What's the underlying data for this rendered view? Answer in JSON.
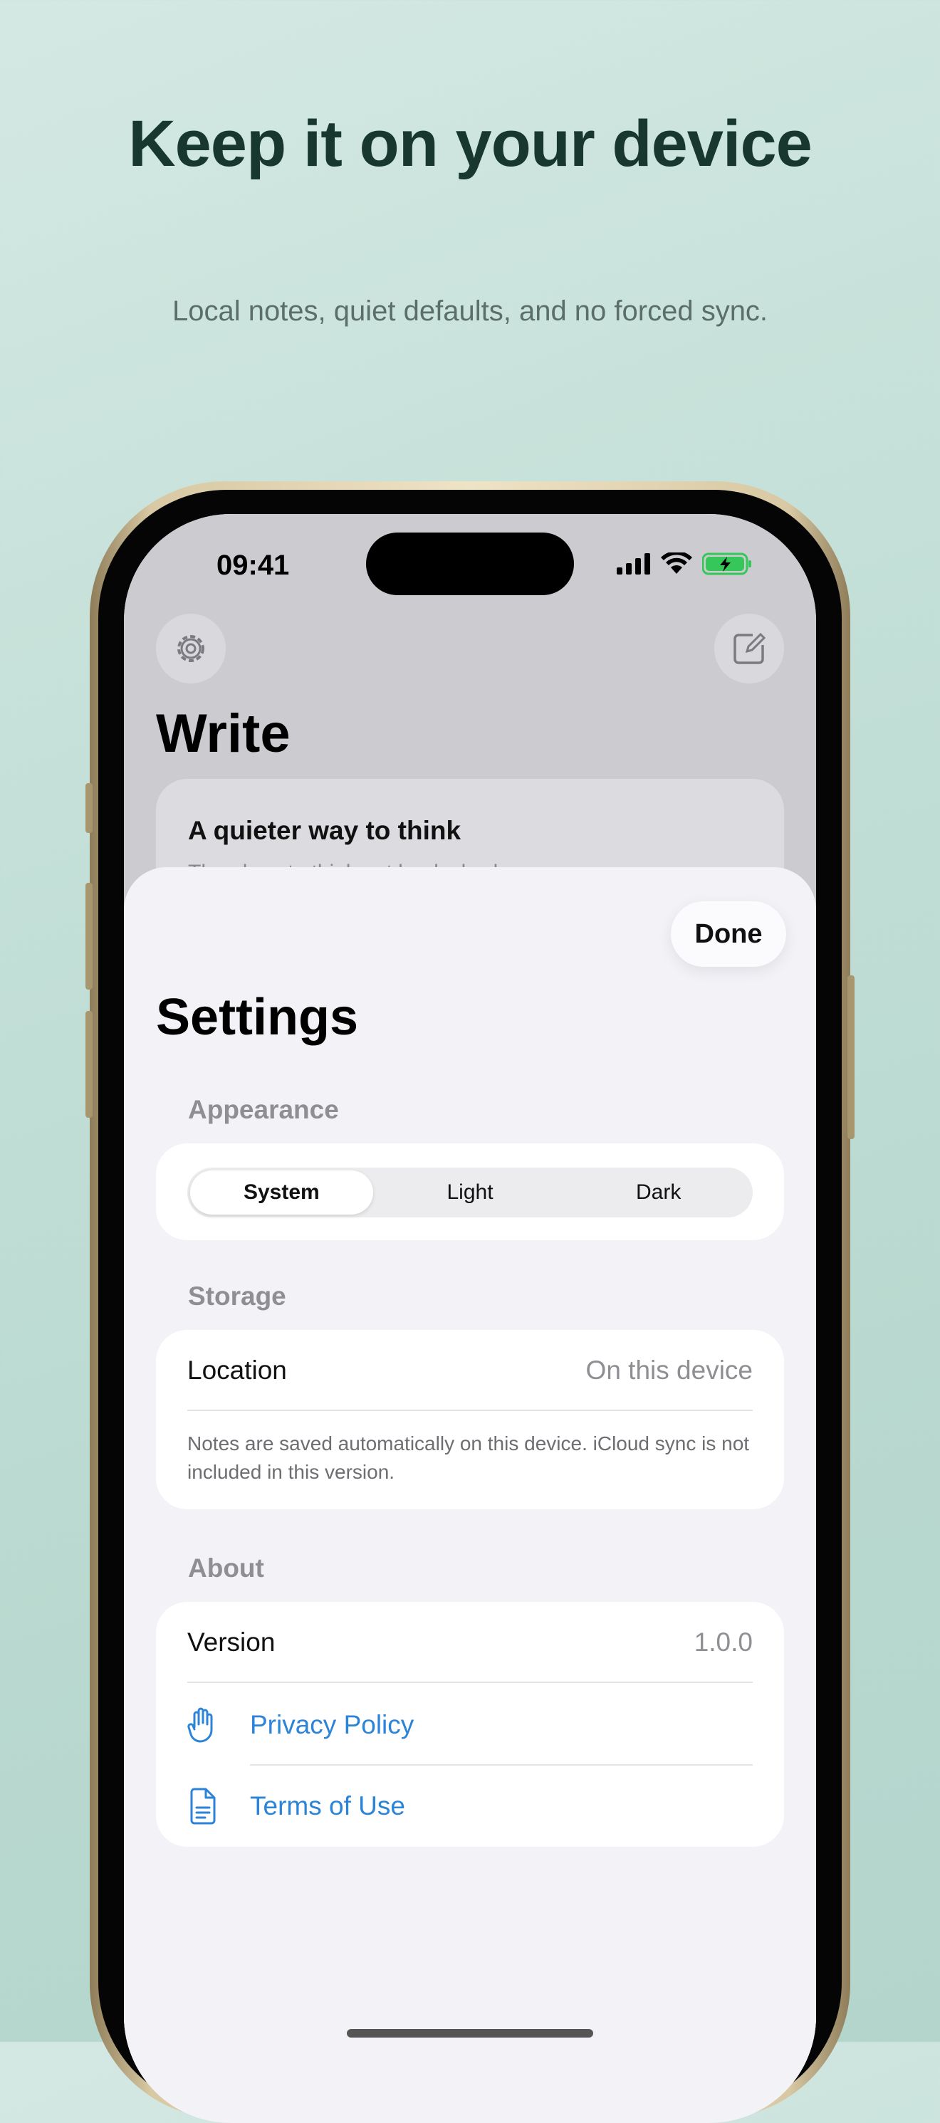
{
  "marketing": {
    "headline": "Keep it on your device",
    "subheadline": "Local notes, quiet defaults, and no forced sync."
  },
  "status_bar": {
    "time": "09:41"
  },
  "app": {
    "title": "Write",
    "note": {
      "title": "A quieter way to think",
      "preview": "The place to think out loud, slowly"
    }
  },
  "settings": {
    "done_label": "Done",
    "title": "Settings",
    "appearance": {
      "label": "Appearance",
      "options": [
        "System",
        "Light",
        "Dark"
      ],
      "selected": "System"
    },
    "storage": {
      "label": "Storage",
      "location_label": "Location",
      "location_value": "On this device",
      "note": "Notes are saved automatically on this device. iCloud sync is not included in this version."
    },
    "about": {
      "label": "About",
      "version_label": "Version",
      "version_value": "1.0.0",
      "privacy_label": "Privacy Policy",
      "terms_label": "Terms of Use"
    }
  },
  "colors": {
    "link": "#2b84d8",
    "battery": "#35c759",
    "headline": "#18382f"
  }
}
